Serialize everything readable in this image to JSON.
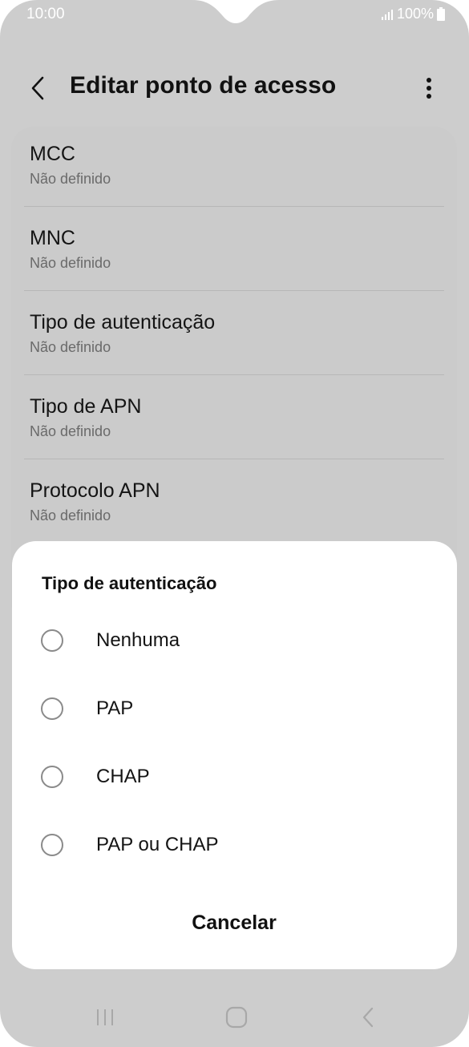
{
  "status_bar": {
    "time": "10:00",
    "battery": "100%",
    "icons": [
      "signal-icon",
      "battery-icon"
    ]
  },
  "header": {
    "title": "Editar ponto de acesso",
    "back_icon": "chevron-left-icon",
    "more_icon": "more-vertical-icon"
  },
  "settings": {
    "items": [
      {
        "title": "MCC",
        "value": "Não definido"
      },
      {
        "title": "MNC",
        "value": "Não definido"
      },
      {
        "title": "Tipo de autenticação",
        "value": "Não definido"
      },
      {
        "title": "Tipo de APN",
        "value": "Não definido"
      },
      {
        "title": "Protocolo APN",
        "value": "Não definido"
      }
    ]
  },
  "dialog": {
    "title": "Tipo de autenticação",
    "options": [
      {
        "label": "Nenhuma",
        "selected": false
      },
      {
        "label": "PAP",
        "selected": false
      },
      {
        "label": "CHAP",
        "selected": false
      },
      {
        "label": "PAP ou CHAP",
        "selected": false
      }
    ],
    "cancel_label": "Cancelar"
  },
  "nav_bar": {
    "buttons": [
      "recent-apps-icon",
      "home-icon",
      "back-icon"
    ]
  },
  "colors": {
    "background_dim": "#cdcdcd",
    "dialog_bg": "#ffffff",
    "text_primary": "#111111",
    "text_secondary": "#6a6a6a"
  }
}
